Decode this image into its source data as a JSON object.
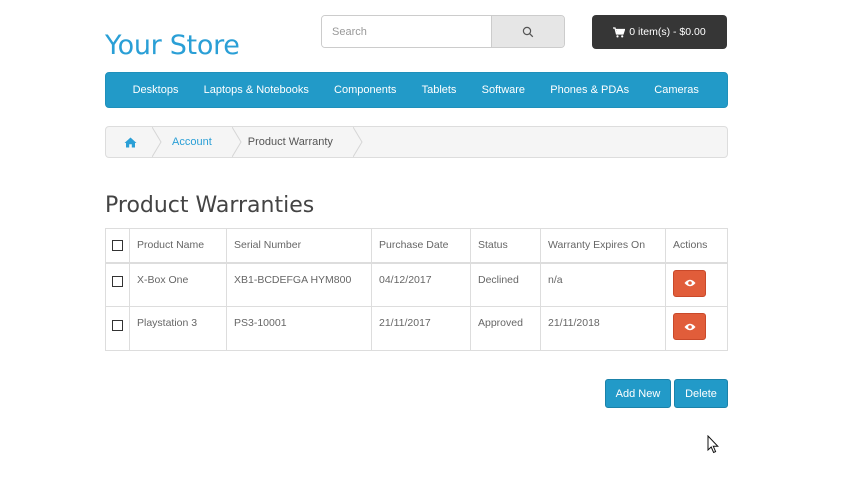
{
  "header": {
    "store_name": "Your Store",
    "search_placeholder": "Search",
    "cart_label": "0 item(s) - $0.00"
  },
  "menu": {
    "items": [
      "Desktops",
      "Laptops & Notebooks",
      "Components",
      "Tablets",
      "Software",
      "Phones & PDAs",
      "Cameras"
    ]
  },
  "breadcrumb": {
    "account": "Account",
    "current": "Product Warranty"
  },
  "page": {
    "title": "Product Warranties"
  },
  "table": {
    "columns": [
      "Product Name",
      "Serial Number",
      "Purchase Date",
      "Status",
      "Warranty Expires On",
      "Actions"
    ],
    "rows": [
      {
        "product": "X-Box One",
        "serial": "XB1-BCDEFGA HYM800",
        "purchase_date": "04/12/2017",
        "status": "Declined",
        "expires": "n/a"
      },
      {
        "product": "Playstation 3",
        "serial": "PS3-10001",
        "purchase_date": "21/11/2017",
        "status": "Approved",
        "expires": "21/11/2018"
      }
    ]
  },
  "buttons": {
    "add_new": "Add New",
    "delete": "Delete"
  },
  "colors": {
    "brand": "#2a9fd6",
    "menu_bg": "#229ac8",
    "view_button": "#e15d3a",
    "cart_bg": "#363636"
  },
  "icons": {
    "search": "search-icon",
    "cart": "cart-icon",
    "home": "home-icon",
    "view": "eye-icon"
  }
}
